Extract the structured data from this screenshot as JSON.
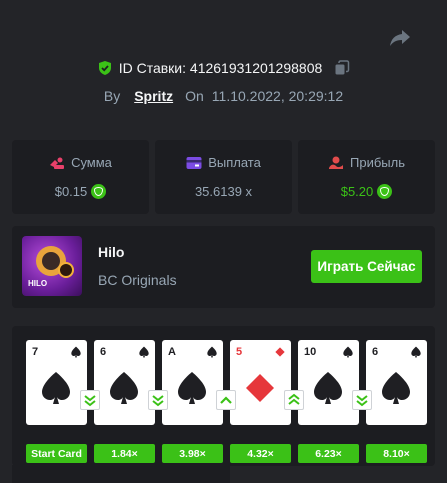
{
  "colors": {
    "accent": "#3bc117",
    "muted": "#98a7b5",
    "panel": "#1c1d21",
    "bg": "#232428",
    "bet_icon": "#e8406a",
    "payout_icon": "#7b4ce3",
    "profit_icon": "#e14c4c"
  },
  "header": {
    "share_icon": "share-icon",
    "bet_id_label": "ID Ставки: 41261931201298808",
    "shield_icon": "shield-check-icon",
    "copy_icon": "copy-icon",
    "by_label": "By",
    "user": "Spritz",
    "on_label": "On",
    "datetime": "11.10.2022, 20:29:12"
  },
  "stats": {
    "bet": {
      "label": "Сумма",
      "value": "$0.15"
    },
    "payout": {
      "label": "Выплата",
      "value": "35.6139 x"
    },
    "profit": {
      "label": "Прибыль",
      "value": "$5.20"
    }
  },
  "game": {
    "name": "Hilo",
    "provider": "BC Originals",
    "thumb_tag": "HILO",
    "play_label": "Играть Сейчас"
  },
  "cards": [
    {
      "rank": "7",
      "suit": "spade",
      "multiplier": "Start Card",
      "next": "lower"
    },
    {
      "rank": "6",
      "suit": "spade",
      "multiplier": "1.84×",
      "next": "lower"
    },
    {
      "rank": "A",
      "suit": "spade",
      "multiplier": "3.98×",
      "next": "higher"
    },
    {
      "rank": "5",
      "suit": "diamond",
      "multiplier": "4.32×",
      "next": "higher"
    },
    {
      "rank": "10",
      "suit": "spade",
      "multiplier": "6.23×",
      "next": "lower"
    },
    {
      "rank": "6",
      "suit": "spade",
      "multiplier": "8.10×",
      "next": null
    }
  ]
}
